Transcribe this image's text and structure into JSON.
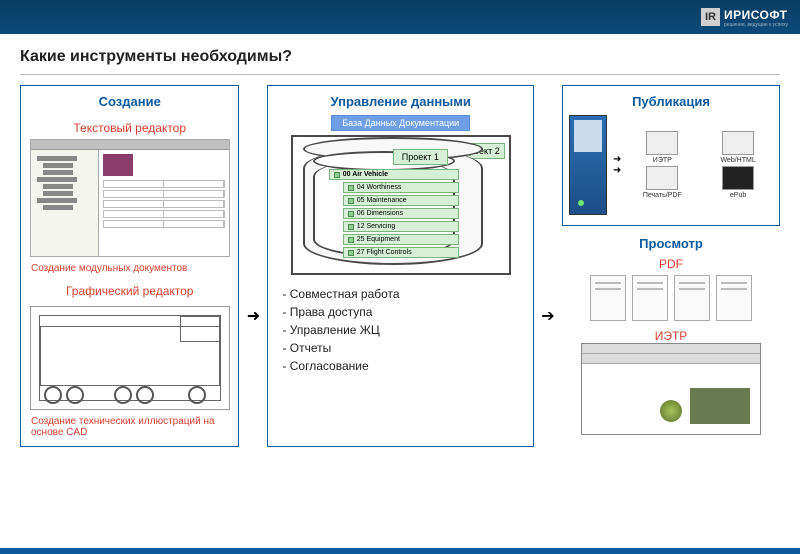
{
  "header": {
    "logo_ir": "IR",
    "brand": "ИРИСОФТ",
    "tagline": "решения, ведущие к успеху"
  },
  "title": "Какие инструменты необходимы?",
  "col1": {
    "title": "Создание",
    "text_editor_label": "Текстовый редактор",
    "text_editor_caption": "Создание модульных документов",
    "graphics_editor_label": "Графический редактор",
    "graphics_editor_caption": "Создание технических иллюстраций на основе CAD"
  },
  "col2": {
    "title": "Управление данными",
    "db_label": "База Данных Документации",
    "project1": "Проект 1",
    "project2": "Проект 2",
    "tree": {
      "root": "00 Air Vehicle",
      "items": [
        "04 Worthiness",
        "05 Maintenance",
        "06 Dimensions",
        "12 Servicing",
        "25 Equipment",
        "27 Flight Controls"
      ]
    },
    "features": [
      "- Совместная работа",
      "- Права доступа",
      "  - Управление ЖЦ",
      "- Отчеты",
      "- Согласование"
    ]
  },
  "col3": {
    "pub_title": "Публикация",
    "outputs": {
      "ietp": "ИЭТР",
      "web": "Web/HTML",
      "print": "Печать/PDF",
      "epub": "ePub"
    },
    "view_title": "Просмотр",
    "pdf_label": "PDF",
    "ietp_label": "ИЭТР"
  }
}
